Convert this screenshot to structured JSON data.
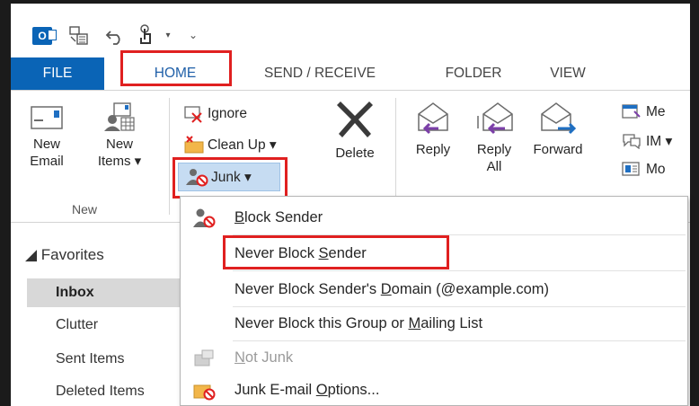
{
  "quick_access": {
    "logo_icon": "outlook-logo-icon",
    "send_receive_icon": "send-receive-all-icon",
    "undo_icon": "undo-icon",
    "touch_icon": "touch-mouse-mode-icon",
    "dropdown_glyph": "▾",
    "customize_glyph": "⌄"
  },
  "tabs": {
    "file": "FILE",
    "home": "HOME",
    "send_receive": "SEND / RECEIVE",
    "folder": "FOLDER",
    "view": "VIEW"
  },
  "ribbon": {
    "new_group": {
      "label": "New",
      "new_email_line1": "New",
      "new_email_line2": "Email",
      "new_items_line1": "New",
      "new_items_line2": "Items ▾"
    },
    "delete_group": {
      "ignore": "Ignore",
      "clean_up": "Clean Up ▾",
      "junk": "Junk ▾",
      "delete": "Delete"
    },
    "respond_group": {
      "reply": "Reply",
      "reply_all_line1": "Reply",
      "reply_all_line2": "All",
      "forward": "Forward",
      "meeting": "Me",
      "im": "IM ▾",
      "more": "Mo"
    }
  },
  "navigation": {
    "favorites_header": "◢ Favorites",
    "folders": [
      "Inbox",
      "Clutter",
      "Sent Items",
      "Deleted Items"
    ]
  },
  "junk_menu": {
    "block_sender": {
      "pre": "",
      "acc": "B",
      "post": "lock Sender"
    },
    "never_block_sender": {
      "pre": "Never Block ",
      "acc": "S",
      "post": "ender"
    },
    "never_block_domain": {
      "pre": "Never Block Sender's ",
      "acc": "D",
      "post": "omain (@example.com)"
    },
    "never_block_group": {
      "pre": "Never Block this Group or ",
      "acc": "M",
      "post": "ailing List"
    },
    "not_junk": {
      "pre": "",
      "acc": "N",
      "post": "ot Junk"
    },
    "junk_options": {
      "pre": "Junk E-mail ",
      "acc": "O",
      "post": "ptions..."
    }
  },
  "colors": {
    "accent_blue": "#0a64b6",
    "highlight_red": "#e02020",
    "junk_hover": "#c6dcf2"
  }
}
